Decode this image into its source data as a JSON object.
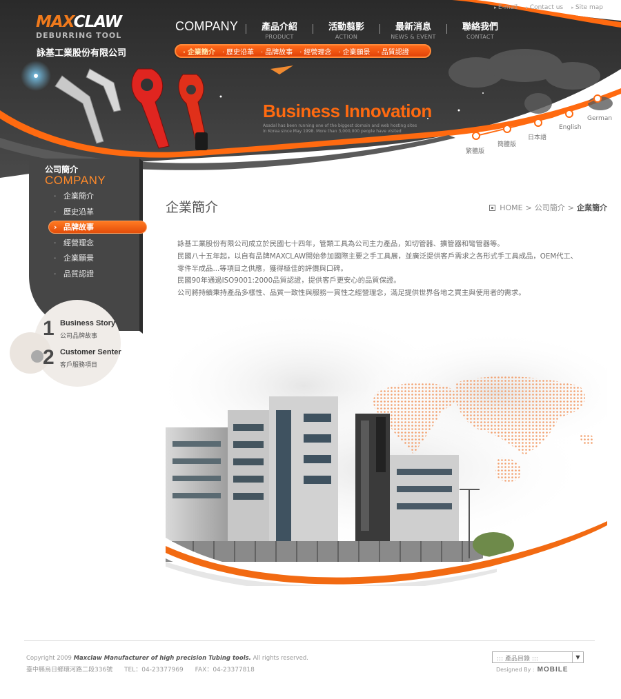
{
  "brand": {
    "logo_prefix": "M",
    "logo_orange": "AX",
    "logo_rest": "CLAW",
    "logo_sub": "DEBURRING TOOL",
    "company": "詠基工業股份有限公司"
  },
  "util_links": [
    "E-mail",
    "Contact us",
    "Site map"
  ],
  "gnb": {
    "first": "COMPANY",
    "items": [
      {
        "zh": "產品介紹",
        "en": "PRODUCT"
      },
      {
        "zh": "活動翦影",
        "en": "ACTION"
      },
      {
        "zh": "最新消息",
        "en": "NEWS & EVENT"
      },
      {
        "zh": "聯絡我們",
        "en": "CONTACT"
      }
    ]
  },
  "subnav": [
    "企業簡介",
    "歷史沿革",
    "品牌故事",
    "經營理念",
    "企業願景",
    "品質認證"
  ],
  "banner": {
    "title": "Business Innovation",
    "desc": "Asadal has been running one of the biggest domain and web hosting sites in Korea since May 1998. More than 3,000,000 people have visited"
  },
  "languages": [
    "繁體版",
    "簡體版",
    "日本語",
    "English",
    "German"
  ],
  "sidebar": {
    "title_zh": "公司簡介",
    "title_en": "COMPANY",
    "items": [
      "企業簡介",
      "歷史沿革",
      "品牌故事",
      "經營理念",
      "企業願景",
      "品質認證"
    ],
    "active_index": 2
  },
  "stories": [
    {
      "num": "1",
      "en": "Business Story",
      "zh": "公司品牌故事"
    },
    {
      "num": "2",
      "en": "Customer Senter",
      "zh": "客戶服務項目"
    }
  ],
  "content": {
    "title": "企業簡介",
    "breadcrumb": {
      "home": "HOME",
      "sep": ">",
      "section": "公司簡介",
      "current": "企業簡介"
    },
    "paragraphs": [
      "詠基工業股份有限公司成立於民國七十四年，管類工具為公司主力產品，如切管器、擴管器和彎管器等。",
      "民國八十五年起，以自有品牌MAXCLAW開始參加國際主要之手工具展，並廣泛提供客戶需求之各形式手工具成品，OEM代工、",
      "零件半成品...等項目之供應，獲得極佳的評價與口碑。",
      "民國90年通過ISO9001:2000品質認證，提供客戶更安心的品質保證。",
      "公司將持續秉持產品多樣性、品質一致性與服務一貫性之經營理念，滿足提供世界各地之買主與使用者的需求。"
    ]
  },
  "footer": {
    "copyright_pre": "Copyright 2009 ",
    "copyright_bold": "Maxclaw Manufacturer of high precision Tubing tools.",
    "copyright_post": " All rights reserved.",
    "address": "臺中縣烏日鄉環河路二段336號",
    "tel": "TEL：04-23377969",
    "fax": "FAX：04-23377818",
    "select_label": "::: 產品目錄 :::",
    "designed_by": "Designed By :",
    "designer": "MOBILE"
  },
  "colors": {
    "accent": "#f26a12",
    "dark": "#3d3d3d"
  }
}
